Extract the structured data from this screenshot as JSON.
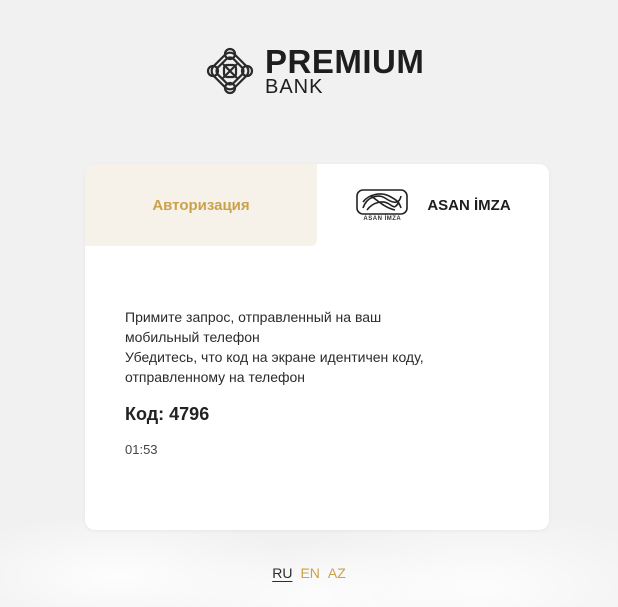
{
  "brand": {
    "line1": "PREMIUM",
    "line2": "BANK"
  },
  "tabs": {
    "auth_label": "Авторизация",
    "asan_label": "ASAN İMZA",
    "asan_logo_text": "ASAN İMZA"
  },
  "auth": {
    "line1": "Примите запрос, отправленный на ваш",
    "line2": "мобильный телефон",
    "line3": "Убедитесь, что код на экране идентичен коду,",
    "line4": "отправленному на телефон",
    "code": "Код: 4796",
    "timer": "01:53"
  },
  "languages": {
    "ru": "RU",
    "en": "EN",
    "az": "AZ",
    "selected": "RU"
  },
  "colors": {
    "accent": "#c9a24b",
    "background": "#f1f1f1",
    "card": "#ffffff",
    "active_tab": "#f6f2ea"
  }
}
